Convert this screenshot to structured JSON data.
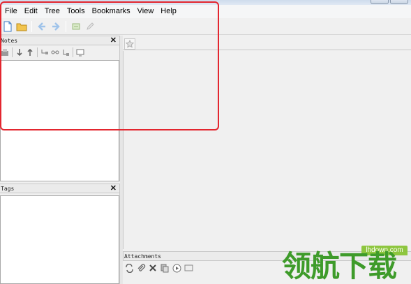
{
  "window": {
    "title": ""
  },
  "menu": [
    "File",
    "Edit",
    "Tree",
    "Tools",
    "Bookmarks",
    "View",
    "Help"
  ],
  "toolbar": {
    "buttons": [
      "new-document-icon",
      "open-folder-icon",
      "back-icon",
      "forward-icon",
      "attach-icon",
      "edit-icon"
    ]
  },
  "notes_pane": {
    "title": "Notes",
    "close": "✕",
    "tools": [
      "add-note-icon",
      "move-down-icon",
      "move-up-icon",
      "indent-icon",
      "link-icon",
      "outdent-icon",
      "view-icon"
    ]
  },
  "tags_pane": {
    "title": "Tags",
    "close": "✕"
  },
  "attachments_pane": {
    "title": "Attachments",
    "tools": [
      "sync-icon",
      "paperclip-icon",
      "delete-icon",
      "copy-icon",
      "play-icon",
      "message-icon"
    ]
  },
  "watermark": {
    "site": "lhdown.com",
    "text": "领航下载"
  },
  "colors": {
    "highlight": "#e3262f",
    "watermark": "#3e9b2a"
  }
}
